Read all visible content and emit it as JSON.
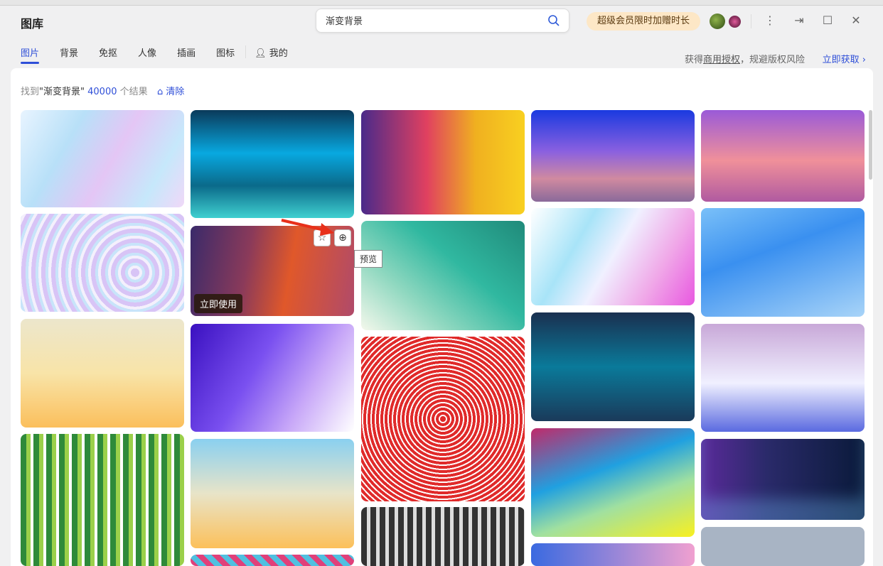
{
  "app_title": "图库",
  "search": {
    "value": "渐变背景"
  },
  "vip_label": "超级会员限时加赠时长",
  "tabs": [
    {
      "label": "图片"
    },
    {
      "label": "背景"
    },
    {
      "label": "免抠"
    },
    {
      "label": "人像"
    },
    {
      "label": "插画"
    },
    {
      "label": "图标"
    },
    {
      "label": "我的"
    }
  ],
  "license": {
    "prefix": "获得",
    "link": "商用授权",
    "suffix": "，规避版权风险",
    "cta": "立即获取"
  },
  "result": {
    "prefix": "找到",
    "query": "\"渐变背景\"",
    "count": "40000",
    "suffix": "个结果",
    "clear": "清除"
  },
  "hover": {
    "use_label": "立即使用",
    "tooltip": "预览"
  }
}
